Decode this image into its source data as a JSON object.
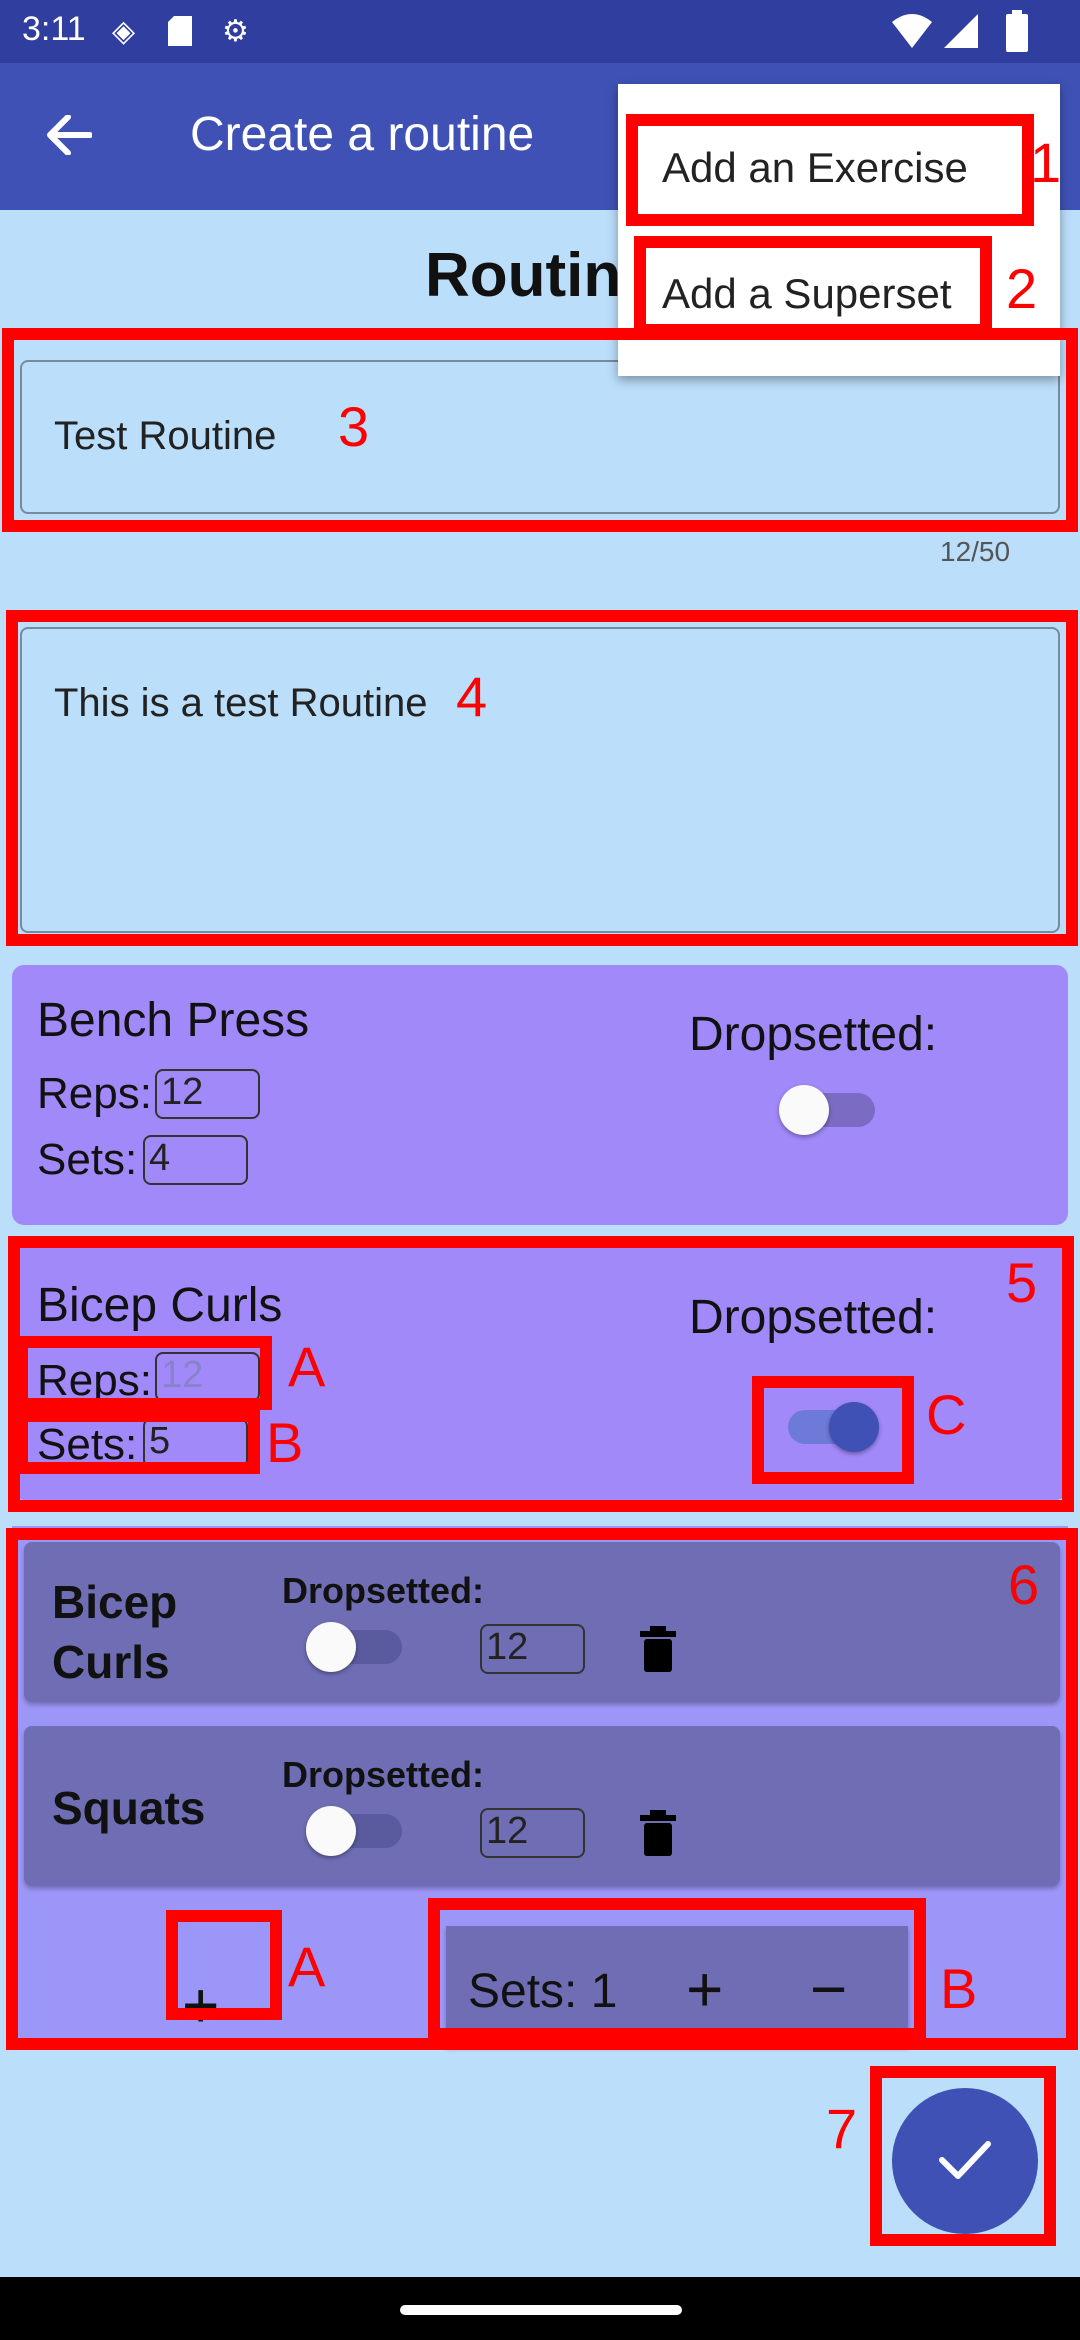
{
  "status_bar": {
    "time": "3:11"
  },
  "app_bar": {
    "title": "Create a routine"
  },
  "menu": {
    "items": [
      "Add an Exercise",
      "Add a Superset"
    ]
  },
  "heading": "Routin",
  "routine_name": {
    "value": "Test Routine",
    "counter": "12/50"
  },
  "routine_description": {
    "value": "This is a test Routine"
  },
  "exercises": [
    {
      "name": "Bench Press",
      "reps_label": "Reps:",
      "reps": "12",
      "sets_label": "Sets:",
      "sets": "4",
      "dropset_label": "Dropsetted:",
      "dropsetted": false
    },
    {
      "name": "Bicep Curls",
      "reps_label": "Reps:",
      "reps": "12",
      "sets_label": "Sets:",
      "sets": "5",
      "dropset_label": "Dropsetted:",
      "dropsetted": true
    }
  ],
  "superset": {
    "rows": [
      {
        "name": "Bicep Curls",
        "dropset_label": "Dropsetted:",
        "reps": "12",
        "dropsetted": false
      },
      {
        "name": "Squats",
        "dropset_label": "Dropsetted:",
        "reps": "12",
        "dropsetted": false
      }
    ],
    "add_symbol": "+",
    "sets_text": "Sets: 1",
    "plus_symbol": "+",
    "minus_symbol": "−"
  },
  "annotations": [
    "1",
    "2",
    "3",
    "4",
    "5",
    "A",
    "B",
    "C",
    "6",
    "A",
    "B",
    "7"
  ],
  "colors": {
    "primary": "#3f51b5",
    "primary_dark": "#303f9f",
    "background": "#bbdefa",
    "card": "#a189fa",
    "superset_area": "#9c96f8",
    "superset_row": "#6f6eb5",
    "annotation_red": "#ff0000"
  },
  "icons": {
    "back": "arrow-left-icon",
    "trash": "trash-icon",
    "fab": "check-icon"
  }
}
